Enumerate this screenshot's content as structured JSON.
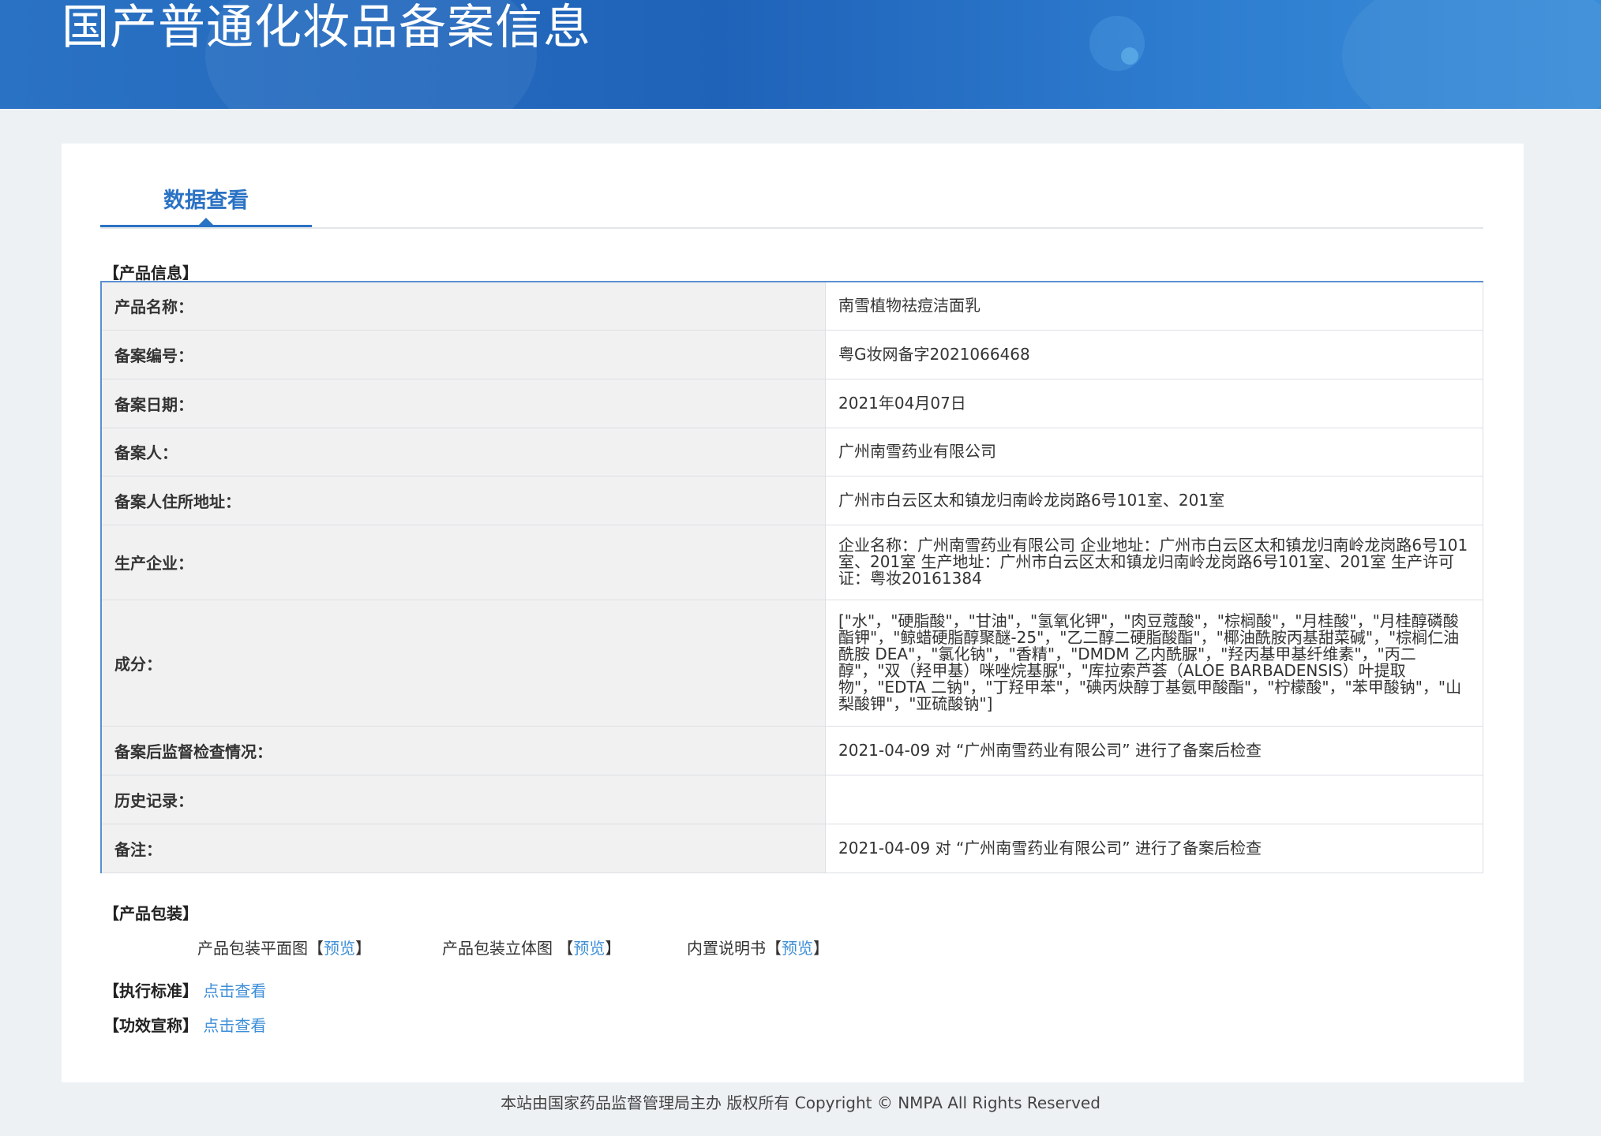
{
  "header": {
    "title": "国产普通化妆品备案信息"
  },
  "tabs": [
    {
      "label": "数据查看"
    }
  ],
  "sections": {
    "product_info": "【产品信息】",
    "product_packaging": "【产品包装】"
  },
  "product_info": [
    {
      "label": "产品名称：",
      "value": "南雪植物祛痘洁面乳"
    },
    {
      "label": "备案编号：",
      "value": "粤G妆网备字2021066468"
    },
    {
      "label": "备案日期：",
      "value": "2021年04月07日"
    },
    {
      "label": "备案人：",
      "value": "广州南雪药业有限公司"
    },
    {
      "label": "备案人住所地址：",
      "value": "广州市白云区太和镇龙归南岭龙岗路6号101室、201室"
    },
    {
      "label": "生产企业：",
      "value": "企业名称：广州南雪药业有限公司 企业地址：广州市白云区太和镇龙归南岭龙岗路6号101室、201室 生产地址：广州市白云区太和镇龙归南岭龙岗路6号101室、201室 生产许可证：粤妆20161384"
    },
    {
      "label": "成分：",
      "value": "[\"水\"，\"硬脂酸\"，\"甘油\"，\"氢氧化钾\"，\"肉豆蔻酸\"，\"棕榈酸\"，\"月桂酸\"，\"月桂醇磷酸酯钾\"，\"鲸蜡硬脂醇聚醚-25\"，\"乙二醇二硬脂酸酯\"，\"椰油酰胺丙基甜菜碱\"，\"棕榈仁油酰胺 DEA\"，\"氯化钠\"，\"香精\"，\"DMDM 乙内酰脲\"，\"羟丙基甲基纤维素\"，\"丙二醇\"，\"双（羟甲基）咪唑烷基脲\"，\"库拉索芦荟（ALOE BARBADENSIS）叶提取物\"，\"EDTA 二钠\"，\"丁羟甲苯\"，\"碘丙炔醇丁基氨甲酸酯\"，\"柠檬酸\"，\"苯甲酸钠\"，\"山梨酸钾\"，\"亚硫酸钠\"]"
    },
    {
      "label": "备案后监督检查情况：",
      "value": "2021-04-09 对 “广州南雪药业有限公司” 进行了备案后检查"
    },
    {
      "label": "历史记录：",
      "value": ""
    },
    {
      "label": "备注：",
      "value": "2021-04-09 对 “广州南雪药业有限公司” 进行了备案后检查"
    }
  ],
  "packaging": [
    {
      "label": "产品包装平面图",
      "link": "预览"
    },
    {
      "label": "产品包装立体图",
      "link": "预览"
    },
    {
      "label": "内置说明书",
      "link": "预览"
    }
  ],
  "standard": {
    "label": "【执行标准】",
    "link": "点击查看"
  },
  "efficacy": {
    "label": "【功效宣称】",
    "link": "点击查看"
  },
  "footer": {
    "text": "本站由国家药品监督管理局主办 版权所有 Copyright © NMPA All Rights Reserved"
  }
}
